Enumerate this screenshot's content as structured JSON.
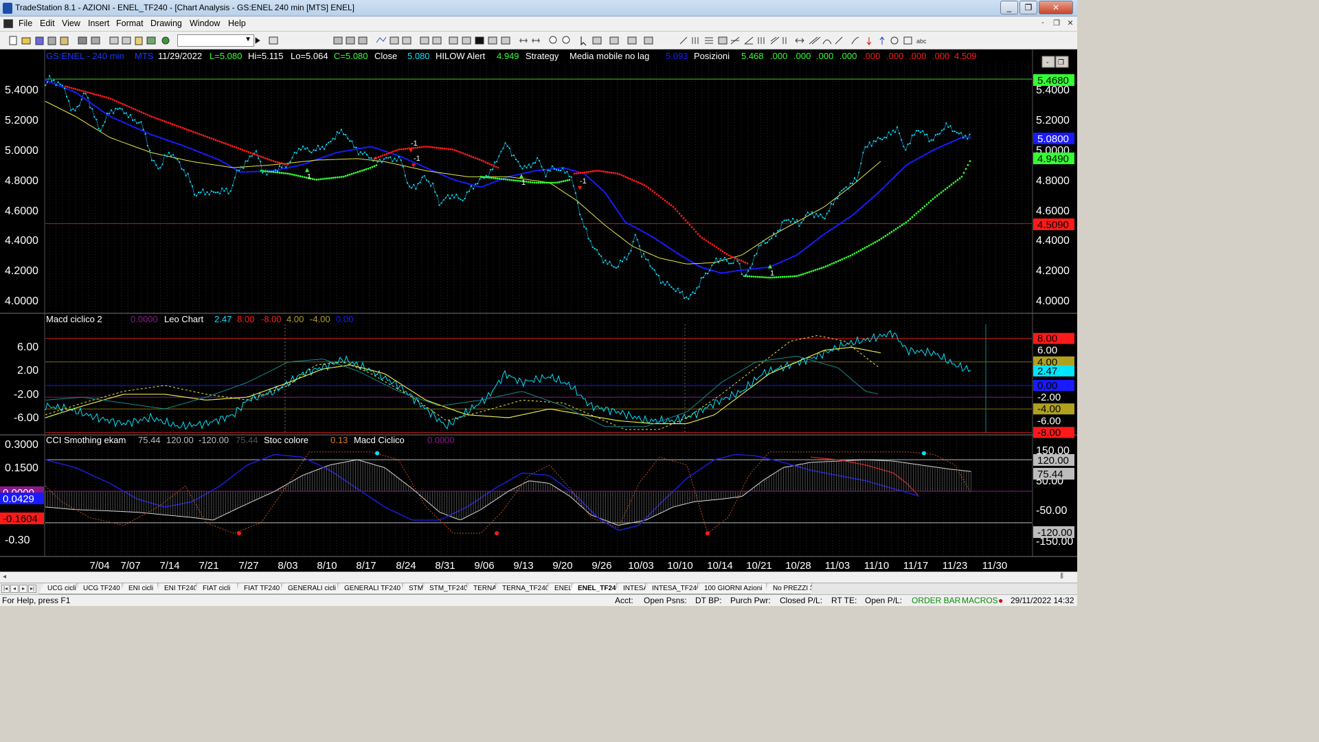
{
  "window": {
    "title": "TradeStation 8.1 - AZIONI - ENEL_TF240 - [Chart Analysis - GS:ENEL  240 min  [MTS] ENEL]",
    "minimize": "_",
    "maximize": "❐",
    "close": "✕"
  },
  "menu": {
    "items": [
      "File",
      "Edit",
      "View",
      "Insert",
      "Format",
      "Drawing",
      "Window",
      "Help"
    ],
    "mdi_buttons": [
      "-",
      "❐",
      "✕"
    ]
  },
  "toolbar": {
    "combo_value": ""
  },
  "chart": {
    "header": {
      "symbol": "GS:ENEL - 240 min",
      "exchange": "MTS",
      "date": "11/29/2022",
      "last": "L=5.080",
      "high": "Hi=5.115",
      "low": "Lo=5.064",
      "close_c": "C=5.080",
      "close_label": "Close",
      "close_val": "5.080",
      "hilow_label": "HILOW Alert",
      "hilow_val": "4.949",
      "strategy_label": "Strategy",
      "media_label": "Media mobile no lag",
      "media_val": "5.093",
      "posizioni_label": "Posizioni",
      "pos_vals": [
        "5.468",
        ".000",
        ".000",
        ".000",
        ".000",
        ".000",
        ".000",
        ".000",
        ".000",
        "4.509"
      ]
    },
    "colors": {
      "background": "#000000",
      "price": "#00e5ff",
      "blue_ma": "#1a1aff",
      "yellow_ma": "#e8e84a",
      "red_stop": "#ff1a1a",
      "green_stop": "#33ff33"
    },
    "price_axis": {
      "ticks": [
        "5.4000",
        "5.2000",
        "5.0000",
        "4.8000",
        "4.6000",
        "4.4000",
        "4.2000",
        "4.0000"
      ],
      "badges": [
        {
          "text": "5.4680",
          "bg": "#33ff33",
          "fg": "#000000"
        },
        {
          "text": "5.0800",
          "bg": "#1a1aff",
          "fg": "#ffffff"
        },
        {
          "text": "4.9490",
          "bg": "#33ff33",
          "fg": "#000000"
        },
        {
          "text": "4.5090",
          "bg": "#ff1a1a",
          "fg": "#000000"
        }
      ]
    },
    "signals": [
      "-1",
      "1",
      "-1",
      "1",
      "-1",
      "1"
    ],
    "panel2": {
      "title": "Macd ciclico 2",
      "val1": "0.0000",
      "leo_label": "Leo Chart",
      "vals": [
        "2.47",
        "8.00",
        "-8.00",
        "4.00",
        "-4.00",
        "0.00"
      ],
      "ticks": [
        "6.00",
        "2.00",
        "-2.00",
        "-6.00"
      ],
      "badges": [
        {
          "text": "8.00",
          "bg": "#ff1a1a",
          "fg": "#000000"
        },
        {
          "text": "6.00",
          "bg": "#000000",
          "fg": "#ffffff"
        },
        {
          "text": "4.00",
          "bg": "#b0a020",
          "fg": "#000000"
        },
        {
          "text": "2.47",
          "bg": "#00e5ff",
          "fg": "#000000"
        },
        {
          "text": "0.00",
          "bg": "#1a1aff",
          "fg": "#000000"
        },
        {
          "text": "-2.00",
          "bg": "#000000",
          "fg": "#ffffff"
        },
        {
          "text": "-4.00",
          "bg": "#b0a020",
          "fg": "#000000"
        },
        {
          "text": "-6.00",
          "bg": "#000000",
          "fg": "#ffffff"
        },
        {
          "text": "-8.00",
          "bg": "#ff1a1a",
          "fg": "#000000"
        }
      ]
    },
    "panel3": {
      "title": "CCI Smothing ekam",
      "vals": [
        "75.44",
        "120.00",
        "-120.00",
        "75.44"
      ],
      "stoc_label": "Stoc colore",
      "stoc_val": "0.13",
      "macd_label": "Macd Ciclico",
      "macd_val": "0.0000",
      "left_ticks": [
        "0.3000",
        "0.1500",
        "-0.30"
      ],
      "left_badges": [
        {
          "text": "0.0000",
          "bg": "#8a1a8a",
          "fg": "#ffffff"
        },
        {
          "text": "0.0429",
          "bg": "#1a1aff",
          "fg": "#ffffff"
        },
        {
          "text": "-0.1604",
          "bg": "#ff1a1a",
          "fg": "#000000"
        }
      ],
      "right_ticks": [
        "150.00",
        "50.00",
        "-50.00",
        "-150.00"
      ],
      "right_badges": [
        {
          "text": "120.00",
          "bg": "#bdbdbd",
          "fg": "#000000"
        },
        {
          "text": "75.44",
          "bg": "#bdbdbd",
          "fg": "#000000"
        },
        {
          "text": "-120.00",
          "bg": "#bdbdbd",
          "fg": "#000000"
        }
      ]
    },
    "date_axis": [
      "7/04",
      "7/07",
      "7/14",
      "7/21",
      "7/27",
      "8/03",
      "8/10",
      "8/17",
      "8/24",
      "8/31",
      "9/06",
      "9/13",
      "9/20",
      "9/26",
      "10/03",
      "10/10",
      "10/14",
      "10/21",
      "10/28",
      "11/03",
      "11/10",
      "11/17",
      "11/23",
      "11/30"
    ]
  },
  "tabs": [
    "UCG cicli",
    "UCG TF240",
    "ENI cicli",
    "ENI TF240",
    "FIAT cicli",
    "FIAT TF240",
    "GENERALI cicli",
    "GENERALI TF240",
    "STM",
    "STM_TF240",
    "TERNA",
    "TERNA_TF240",
    "ENEL",
    "ENEL_TF240",
    "INTESA",
    "INTESA_TF240",
    "100 GIORNI Azioni",
    "No PREZZI 3"
  ],
  "active_tab": "ENEL_TF240",
  "status": {
    "help": "For Help, press F1",
    "acct": "Acct:",
    "open_psns": "Open Psns:",
    "dt_bp": "DT BP:",
    "purch_pwr": "Purch Pwr:",
    "closed_pl": "Closed P/L:",
    "rt_te": "RT TE:",
    "open_pl": "Open P/L:",
    "order_bar": "ORDER BAR",
    "macros": "MACROS",
    "datetime": "29/11/2022 14:32"
  }
}
